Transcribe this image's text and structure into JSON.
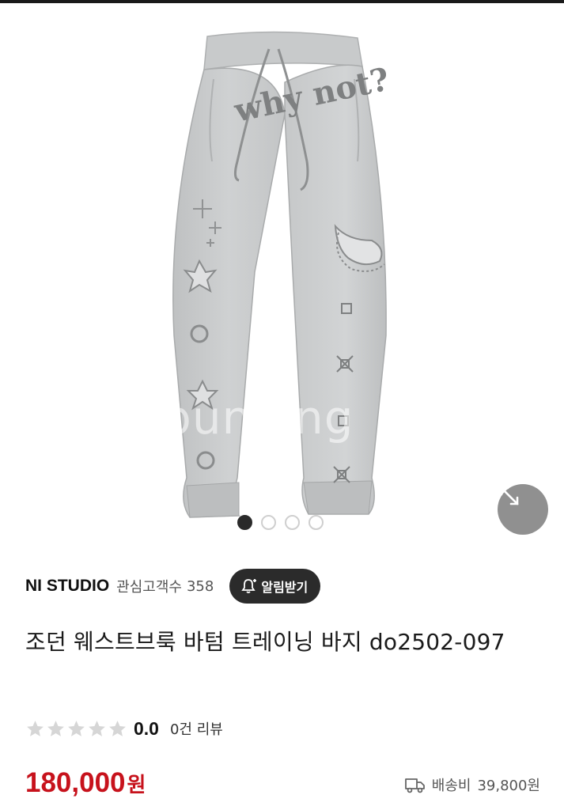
{
  "gallery": {
    "image_alt": "light grey sweatpants product photo",
    "image_count": 4,
    "active_index": 0,
    "print_text": "why not?",
    "watermark": "bunjang",
    "icons": {
      "expand": "expand-diagonal-icon"
    }
  },
  "seller": {
    "name": "NI STUDIO",
    "follower_label": "관심고객수",
    "follower_count": "358",
    "alert_button_label": "알림받기",
    "alert_icon": "bell-plus-icon"
  },
  "product": {
    "title": "조던 웨스트브룩 바텀 트레이닝 바지 do2502-097"
  },
  "rating": {
    "stars_filled": 0,
    "stars_total": 5,
    "value": "0.0",
    "review_count": "0건 리뷰",
    "icon": "star-icon"
  },
  "price": {
    "amount": "180,000",
    "unit": "원"
  },
  "shipping": {
    "icon": "truck-icon",
    "label": "배송비",
    "amount": "39,800원"
  },
  "colors": {
    "price": "#c7121c",
    "button_dark": "#2b2b2b",
    "pants": "#c9cbcc"
  }
}
